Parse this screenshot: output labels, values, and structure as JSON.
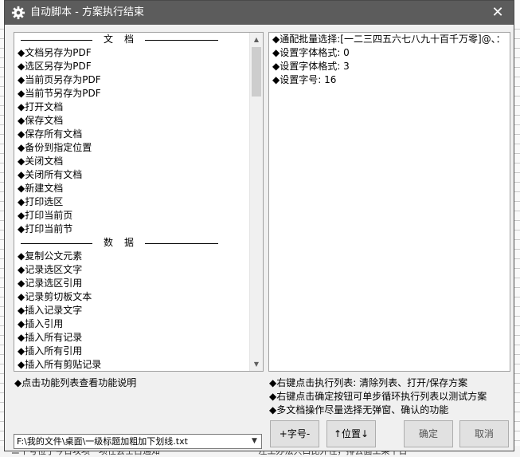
{
  "window": {
    "title": "自动脚本 - 方案执行结束",
    "close_glyph": "✕"
  },
  "function_list": {
    "sections": [
      {
        "header": "文档",
        "items": [
          "◆文档另存为PDF",
          "◆选区另存为PDF",
          "◆当前页另存为PDF",
          "◆当前节另存为PDF",
          "◆打开文档",
          "◆保存文档",
          "◆保存所有文档",
          "◆备份到指定位置",
          "◆关闭文档",
          "◆关闭所有文档",
          "◆新建文档",
          "◆打印选区",
          "◆打印当前页",
          "◆打印当前节"
        ]
      },
      {
        "header": "数据",
        "items": [
          "◆复制公文元素",
          "◆记录选区文字",
          "◆记录选区引用",
          "◆记录剪切板文本",
          "◆插入记录文字",
          "◆插入引用",
          "◆插入所有记录",
          "◆插入所有引用",
          "◆插入所有剪贴记录"
        ]
      }
    ]
  },
  "execution_list": {
    "items": [
      "◆通配批量选择:[一二三四五六七八九十百千万零]@、：",
      "◆设置字体格式: 0",
      "◆设置字体格式: 3",
      "◆设置字号: 16"
    ]
  },
  "notes": {
    "left": "◆点击功能列表查看功能说明",
    "right": [
      "◆右键点击执行列表: 清除列表、打开/保存方案",
      "◆右键点击确定按钮可单步循环执行列表以测试方案",
      "◆多文档操作尽量选择无弹窗、确认的功能"
    ]
  },
  "controls": {
    "file_path": "F:\\我的文件\\桌面\\一级标题加粗加下划线.txt",
    "font_size_button": "+字号-",
    "position_button": "↑位置↓",
    "ok_button": "确定",
    "cancel_button": "取消"
  },
  "background": {
    "bottom_text_left": "ニ十号位于今日攻项一项仕会士占通知",
    "bottom_text_right": "左工办法只口比外径，排去面工乘十日"
  },
  "colors": {
    "titlebar": "#5c5c5c",
    "dialog_bg": "#f0f0f0",
    "list_bg": "#ffffff"
  }
}
